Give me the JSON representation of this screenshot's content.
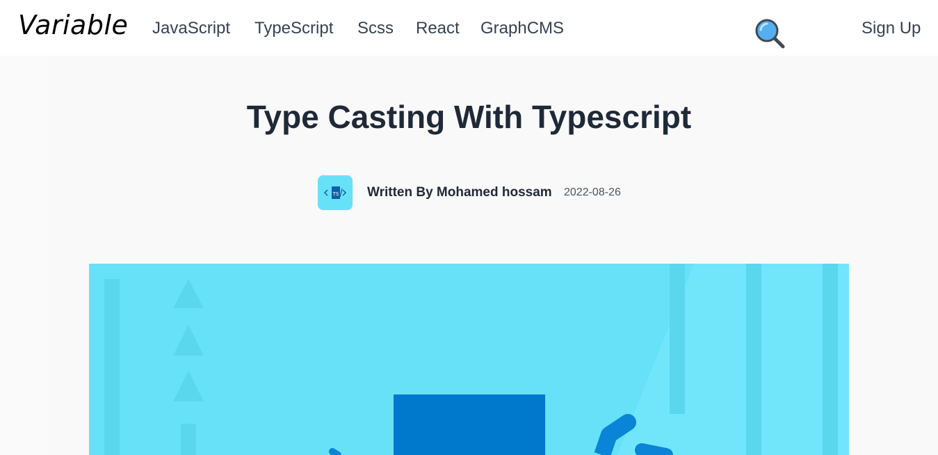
{
  "header": {
    "logo": "Variable",
    "nav": [
      "JavaScript",
      "TypeScript",
      "Scss",
      "React",
      "GraphCMS"
    ],
    "signup": "Sign Up"
  },
  "article": {
    "title": "Type Casting With Typescript",
    "author": "Written By Mohamed hossam",
    "date": "2022-08-26"
  },
  "icons": {
    "search": "magnifying-glass-icon"
  },
  "colors": {
    "hero_bg": "#67e1f8",
    "hero_accent": "#0078cc"
  }
}
